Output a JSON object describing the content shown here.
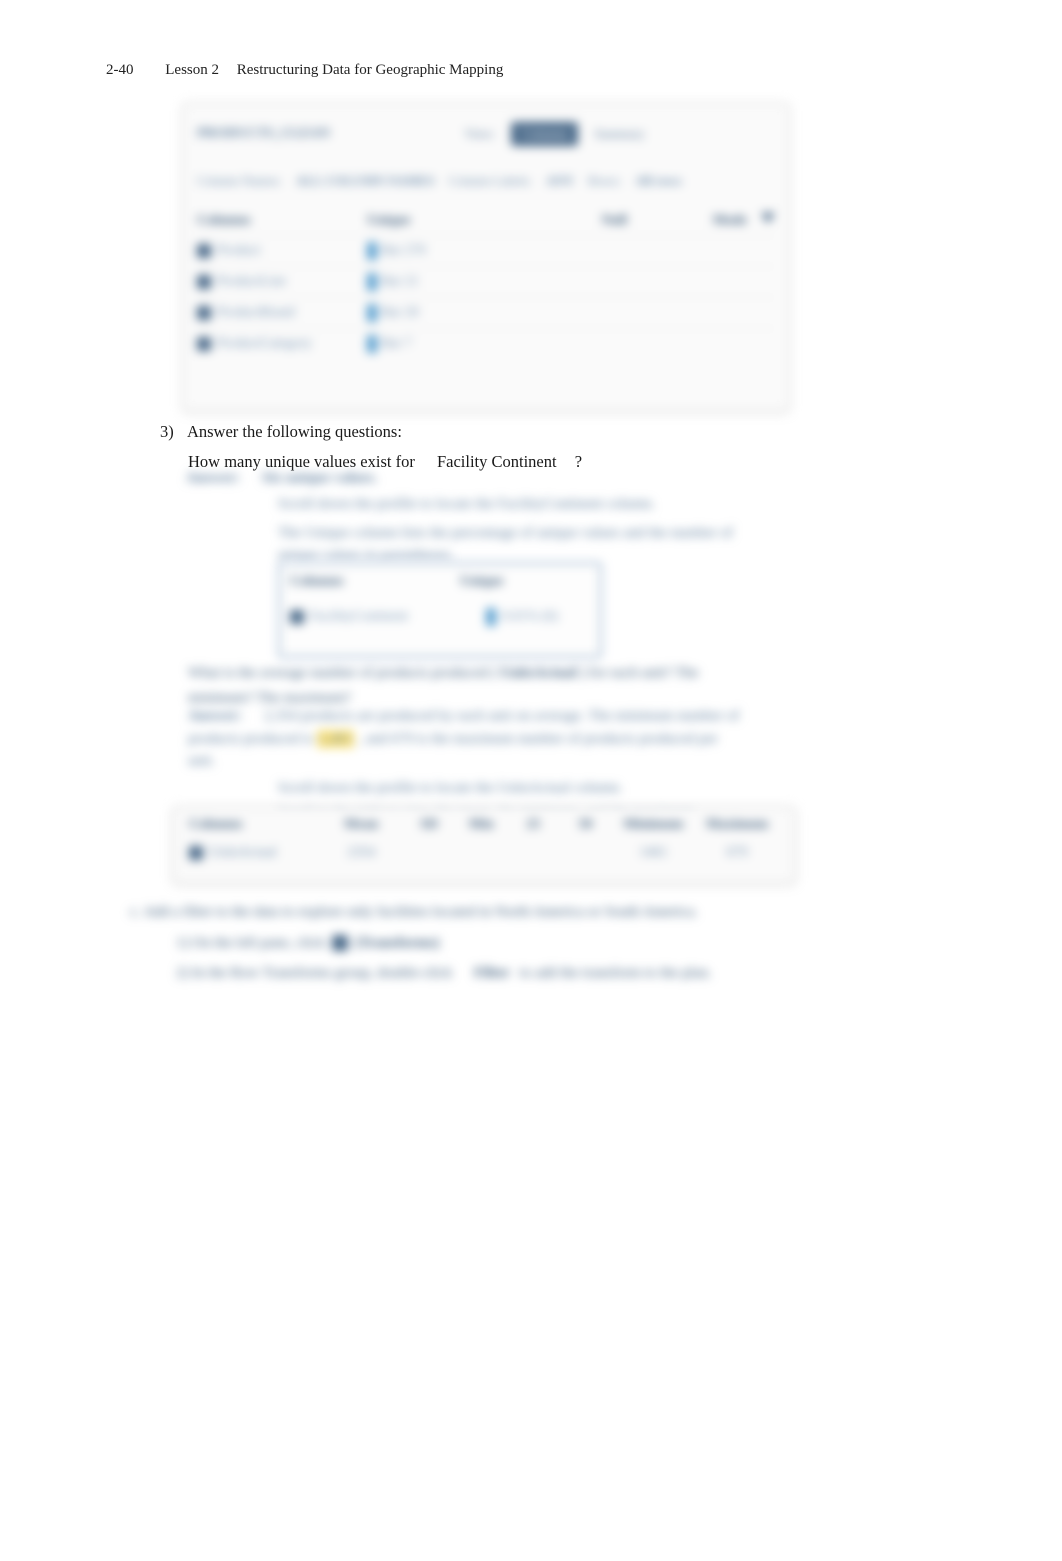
{
  "header": {
    "page_number": "2-40",
    "lesson_label": "Lesson 2",
    "lesson_title": "Restructuring Data for Geographic Mapping"
  },
  "panel1": {
    "title": "PRODUCTS_CLEAN",
    "view_label": "View:",
    "tabs": [
      "Summary",
      "Columns"
    ],
    "active_tab": "Columns",
    "toolbar": {
      "label1": "Column Names:",
      "value1": "ALL COLUMN NAMES",
      "label2": "Column Labels:",
      "value2": "ANY",
      "label3": "Rows:",
      "value3": "All rows"
    },
    "columns": [
      "Columns",
      "Unique",
      "Null",
      "Mode"
    ],
    "rows": [
      {
        "name": "Product",
        "unique": "Bar 270"
      },
      {
        "name": "ProductLine",
        "unique": "Bar 21"
      },
      {
        "name": "ProductBrand",
        "unique": "Bar 20"
      },
      {
        "name": "ProductCategory",
        "unique": "Bar 7"
      }
    ]
  },
  "question": {
    "number": "3)",
    "prompt": "Answer the following questions:",
    "sub": "How many unique values exist for",
    "field": "Facility Continent",
    "qmark": "?"
  },
  "answer1": {
    "label": "Answer:",
    "text": "Six unique values.",
    "bullet1": "Scroll down the profile to locate the FacilityContinent column.",
    "bullet2": "The Unique column lists the percentage of unique values and the number of unique values in parentheses."
  },
  "small_box": {
    "col1": "Columns",
    "col2": "Unique",
    "row_name": "FacilityContinent",
    "row_val": "0.01% (6)"
  },
  "q2": {
    "line1": "What is the average number of products produced (",
    "field": "UnitsActual",
    "line1b": ") for each unit? The",
    "line2": "minimum? The maximum?"
  },
  "answer2": {
    "label": "Answer:",
    "line1a": "2,354 products are produced by each unit on average. The minimum number of products produced is",
    "hl1": "1,461",
    "line1b": ", and 679 is the maximum number of products produced per unit.",
    "bullet1": "Scroll down the profile to locate the UnitsActual column.",
    "bullet2": "Scroll to the right to view the mean, the minimum, and the maximum."
  },
  "panel2": {
    "cols": [
      "Columns",
      "Mean",
      "SD",
      "Min",
      "25",
      "50",
      "Minimum",
      "Maximum"
    ],
    "row_name": "UnitsActual",
    "row_vals": [
      "2354",
      "",
      "",
      "",
      "",
      "1461",
      "679"
    ]
  },
  "bottom": {
    "line1": "c. Add a filter to the data to explore only facilities located in North America or South America.",
    "line2a": "1) On the left pane, click",
    "line2b": "(Transforms)",
    "line3a": "2) In the Row Transforms group, double-click",
    "line3b": "Filter",
    "line3c": "to add the transform to the plan."
  }
}
